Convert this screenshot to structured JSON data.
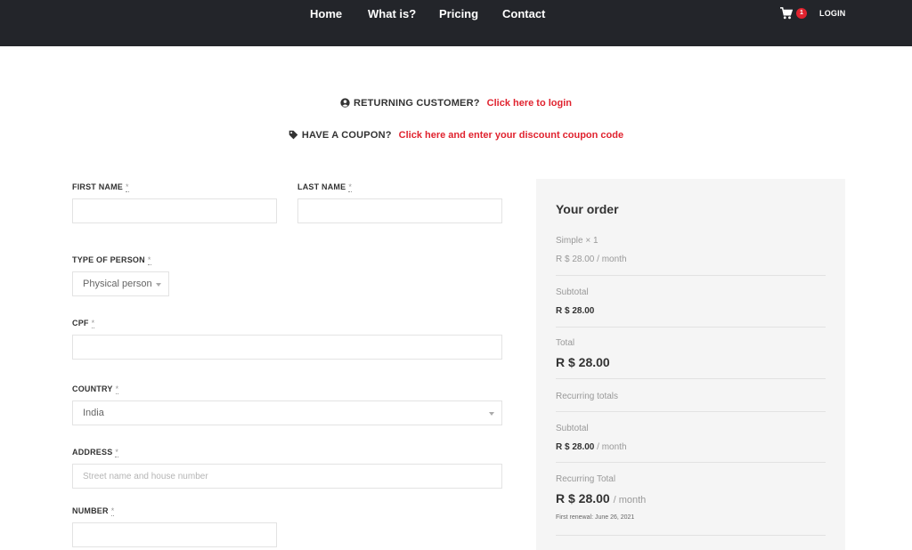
{
  "nav": {
    "items": [
      "Home",
      "What is?",
      "Pricing",
      "Contact"
    ],
    "cart_count": "1",
    "login_label": "LOGIN",
    "cart_icon": "shopping-cart-icon"
  },
  "notices": {
    "returning_label": "RETURNING CUSTOMER?",
    "returning_link": "Click here to login",
    "coupon_label": "HAVE A COUPON?",
    "coupon_link": "Click here and enter your discount coupon code",
    "user_icon": "user-circle-icon",
    "tag_icon": "tag-icon"
  },
  "form": {
    "required_mark": "*",
    "first_name_label": "FIRST NAME",
    "first_name_value": "",
    "last_name_label": "LAST NAME",
    "last_name_value": "",
    "person_type_label": "TYPE OF PERSON",
    "person_type_value": "Physical person",
    "cpf_label": "CPF",
    "cpf_value": "",
    "country_label": "COUNTRY",
    "country_value": "India",
    "address_label": "ADDRESS",
    "address_placeholder": "Street name and house number",
    "number_label": "NUMBER",
    "number_value": ""
  },
  "order": {
    "title": "Your order",
    "product_name": "Simple",
    "product_qty": "× 1",
    "product_price": "R $ 28.00",
    "per_month": "/ month",
    "subtotal_label": "Subtotal",
    "subtotal_value": "R $ 28.00",
    "total_label": "Total",
    "total_value": "R $ 28.00",
    "recurring_totals_label": "Recurring totals",
    "recurring_subtotal_label": "Subtotal",
    "recurring_subtotal_value": "R $ 28.00",
    "recurring_total_label": "Recurring Total",
    "recurring_total_value": "R $ 28.00",
    "first_renewal": "First renewal: June 26, 2021"
  },
  "colors": {
    "header_bg": "#23252a",
    "accent_red": "#e0232f",
    "summary_bg": "#f5f5f5"
  }
}
